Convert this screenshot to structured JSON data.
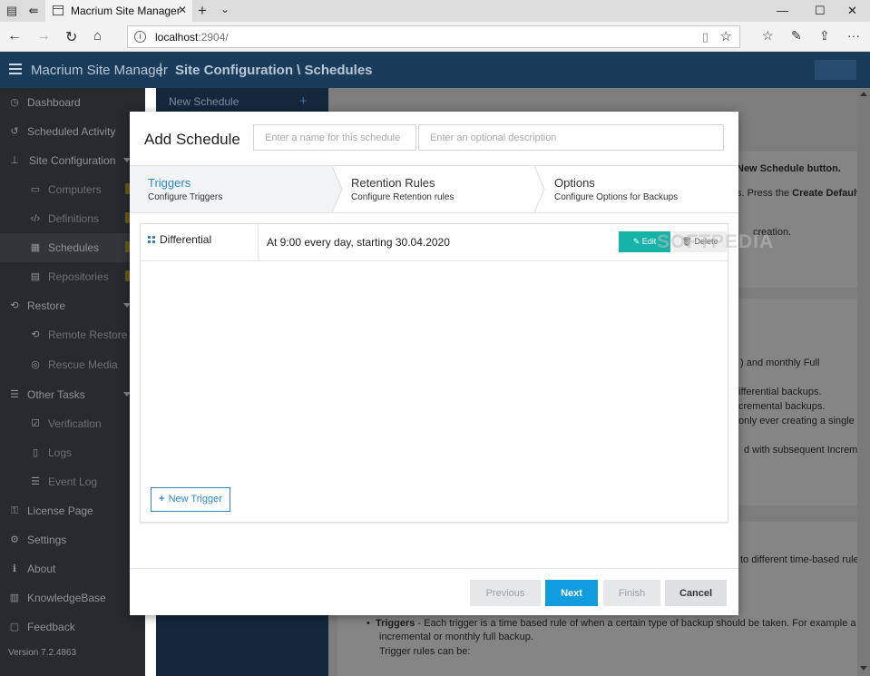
{
  "browser": {
    "tab_title": "Macrium Site Manager",
    "url_host": "localhost",
    "url_rest": ":2904/"
  },
  "header": {
    "app_name": "Macrium Site Manager",
    "separator": "|",
    "breadcrumb": "Site Configuration \\ Schedules"
  },
  "sidebar": {
    "items": [
      {
        "label": "Dashboard",
        "icon": "dashboard-icon"
      },
      {
        "label": "Scheduled Activity",
        "icon": "history-icon"
      },
      {
        "label": "Site Configuration",
        "icon": "sitemap-icon"
      },
      {
        "label": "Computers",
        "icon": "monitor-icon"
      },
      {
        "label": "Definitions",
        "icon": "code-icon"
      },
      {
        "label": "Schedules",
        "icon": "calendar-icon"
      },
      {
        "label": "Repositories",
        "icon": "database-icon"
      },
      {
        "label": "Restore",
        "icon": "restore-icon"
      },
      {
        "label": "Remote Restore",
        "icon": "remote-restore-icon"
      },
      {
        "label": "Rescue Media",
        "icon": "lifebuoy-icon"
      },
      {
        "label": "Other Tasks",
        "icon": "tasks-icon"
      },
      {
        "label": "Verification",
        "icon": "check-icon"
      },
      {
        "label": "Logs",
        "icon": "file-icon"
      },
      {
        "label": "Event Log",
        "icon": "list-icon"
      },
      {
        "label": "License Page",
        "icon": "key-icon"
      },
      {
        "label": "Settings",
        "icon": "cogs-icon"
      },
      {
        "label": "About",
        "icon": "info-icon"
      },
      {
        "label": "KnowledgeBase",
        "icon": "book-icon"
      },
      {
        "label": "Feedback",
        "icon": "comment-icon"
      }
    ],
    "version": "Version 7.2.4863"
  },
  "schedules_column": {
    "new_schedule": "New Schedule",
    "add": "+"
  },
  "main": {
    "lines": [
      "New Schedule button.",
      "s. Press the Create Default",
      "creation.",
      ") and monthly Full",
      "ifferential backups.",
      "cremental backups.",
      "only ever creating a single F",
      "d with subsequent Increme",
      "to different time-based rule",
      "Each trigger is a time based rule of when a certain type of backup should be taken. For example a da",
      "incremental or monthly full backup.",
      "Trigger rules can be:"
    ],
    "bold_phrase": "Create Default",
    "triggers_bold": "Triggers",
    "triggers_dash": " - "
  },
  "modal": {
    "title": "Add Schedule",
    "name_placeholder": "Enter a name for this schedule",
    "desc_placeholder": "Enter an optional description",
    "steps": [
      {
        "title": "Triggers",
        "subtitle": "Configure Triggers"
      },
      {
        "title": "Retention Rules",
        "subtitle": "Configure Retention rules"
      },
      {
        "title": "Options",
        "subtitle": "Configure Options for Backups"
      }
    ],
    "trigger": {
      "type": "Differential",
      "description": "At 9:00 every day, starting 30.04.2020",
      "edit": "Edit",
      "delete": "Delete"
    },
    "new_trigger": "New Trigger",
    "buttons": {
      "previous": "Previous",
      "next": "Next",
      "finish": "Finish",
      "cancel": "Cancel"
    }
  },
  "watermark": "SOFTPEDIA",
  "colors": {
    "header": "#1b3b5a",
    "sidebar": "#272a2e",
    "accent_blue": "#119ce0",
    "edit_teal": "#17b3a8",
    "step_active": "#3188c8"
  }
}
